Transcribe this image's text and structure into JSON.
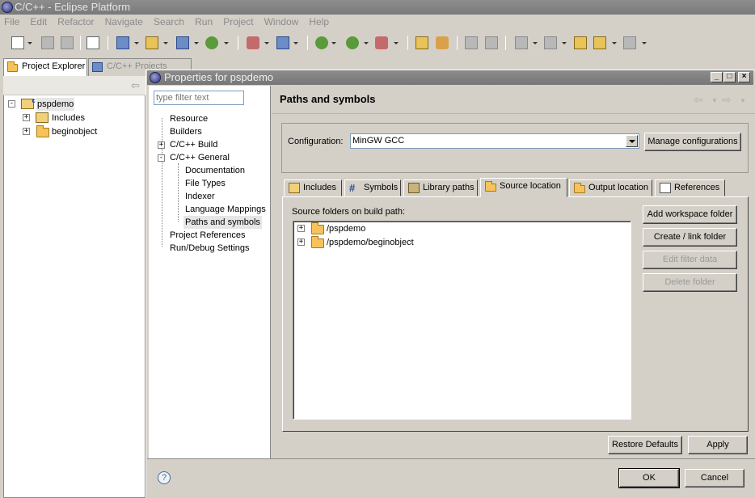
{
  "app": {
    "title": "C/C++ - Eclipse Platform"
  },
  "menubar": [
    "File",
    "Edit",
    "Refactor",
    "Navigate",
    "Search",
    "Run",
    "Project",
    "Window",
    "Help"
  ],
  "explorer": {
    "tabs": [
      {
        "label": "Project Explorer",
        "icon": "folder-icon"
      },
      {
        "label": "C/C++ Projects",
        "icon": "cpp-projects-icon"
      }
    ],
    "tree": [
      {
        "label": "pspdemo",
        "icon": "c-project-icon",
        "toggle": "-"
      },
      {
        "label": "Includes",
        "icon": "includes-icon",
        "toggle": "+"
      },
      {
        "label": "beginobject",
        "icon": "source-folder-icon",
        "toggle": "+"
      }
    ]
  },
  "dialog": {
    "title": "Properties for pspdemo",
    "filter_placeholder": "type filter text",
    "nav": [
      {
        "label": "Resource"
      },
      {
        "label": "Builders"
      },
      {
        "label": "C/C++ Build",
        "toggle": "+"
      },
      {
        "label": "C/C++ General",
        "toggle": "-"
      },
      {
        "label": "Documentation"
      },
      {
        "label": "File Types"
      },
      {
        "label": "Indexer"
      },
      {
        "label": "Language Mappings"
      },
      {
        "label": "Paths and symbols"
      },
      {
        "label": "Project References"
      },
      {
        "label": "Run/Debug Settings"
      }
    ],
    "page_title": "Paths and symbols",
    "configuration": {
      "label": "Configuration:",
      "value": "MinGW GCC",
      "manage_label": "Manage configurations"
    },
    "tabs": [
      {
        "label": "Includes",
        "icon": "includes-icon"
      },
      {
        "label": "Symbols",
        "icon": "hash-icon"
      },
      {
        "label": "Library paths",
        "icon": "library-icon"
      },
      {
        "label": "Source location",
        "icon": "folder-icon"
      },
      {
        "label": "Output location",
        "icon": "output-folder-icon"
      },
      {
        "label": "References",
        "icon": "references-icon"
      }
    ],
    "source_panel": {
      "label": "Source folders on build path:",
      "folders": [
        {
          "path": "/pspdemo",
          "toggle": "+"
        },
        {
          "path": "/pspdemo/beginobject",
          "toggle": "+"
        }
      ],
      "buttons": {
        "add_workspace": "Add workspace folder",
        "create_link": "Create / link folder",
        "edit_filter": "Edit filter data",
        "delete": "Delete folder"
      }
    },
    "restore_defaults": "Restore Defaults",
    "apply": "Apply",
    "ok": "OK",
    "cancel": "Cancel",
    "help": "?"
  },
  "colors": {
    "title_bar": "#808080",
    "face": "#d4d0c8",
    "selection": "#e6e6e6"
  }
}
